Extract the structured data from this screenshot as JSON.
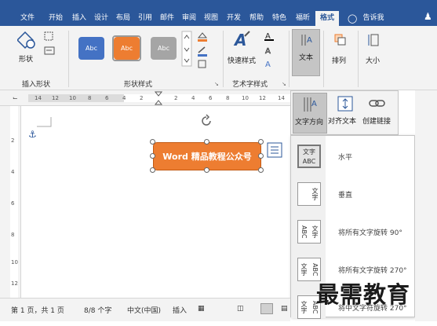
{
  "tabs": [
    "文件",
    "开始",
    "插入",
    "设计",
    "布局",
    "引用",
    "邮件",
    "审阅",
    "视图",
    "开发",
    "帮助",
    "特色",
    "福昕",
    "格式",
    "告诉我"
  ],
  "active_tab": "格式",
  "ribbon": {
    "insert_shapes_label": "插入形状",
    "shape_label": "形状",
    "shape_styles_label": "形状样式",
    "style_abc": "Abc",
    "quick_styles_label": "快速样式",
    "art_styles_label": "艺术字样式",
    "text_label": "文本",
    "arrange_label": "排列",
    "size_label": "大小"
  },
  "popup": {
    "text_direction": "文字方向",
    "align_text": "对齐文本",
    "create_link": "创建链接"
  },
  "ruler_h": [
    "14",
    "12",
    "10",
    "8",
    "6",
    "4",
    "2",
    "",
    "2",
    "4",
    "6",
    "8",
    "10",
    "12",
    "14"
  ],
  "ruler_v": [
    "2",
    "4",
    "6",
    "8",
    "10",
    "12"
  ],
  "textbox_text": "Word 精品教程公众号",
  "text_direction_options": [
    {
      "label": "水平",
      "icon": "文字\nABC"
    },
    {
      "label": "垂直",
      "icon": "文字"
    },
    {
      "label": "将所有文字旋转 90°",
      "icon": "文字ABC"
    },
    {
      "label": "将所有文字旋转 270°",
      "icon": "文字ABC"
    },
    {
      "label": "将中文字符旋转 270°",
      "icon": "文字ABC"
    }
  ],
  "status": {
    "page": "第 1 页，共 1 页",
    "words": "8/8 个字",
    "lang": "中文(中国)",
    "mode": "插入"
  },
  "watermark": "最需教育",
  "colors": {
    "ribbon_blue": "#2b579a",
    "shape_orange": "#ed7d31",
    "style_blue": "#4472c4",
    "style_gray": "#a5a5a5"
  }
}
